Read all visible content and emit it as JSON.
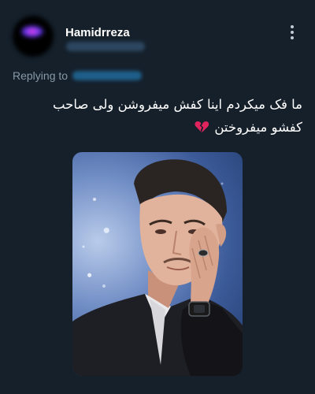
{
  "tweet": {
    "display_name": "Hamidrreza",
    "replying_to_label": "Replying to",
    "text_line1": "ما فک میکردم اینا کفش میفروشن ولی صاحب",
    "text_line2": "کفشو میفروختن",
    "emoji": "broken-heart-icon"
  },
  "colors": {
    "background": "#15202b",
    "secondary_text": "#8899a6",
    "link": "#1d9bf0",
    "broken_heart": "#e0245e"
  }
}
